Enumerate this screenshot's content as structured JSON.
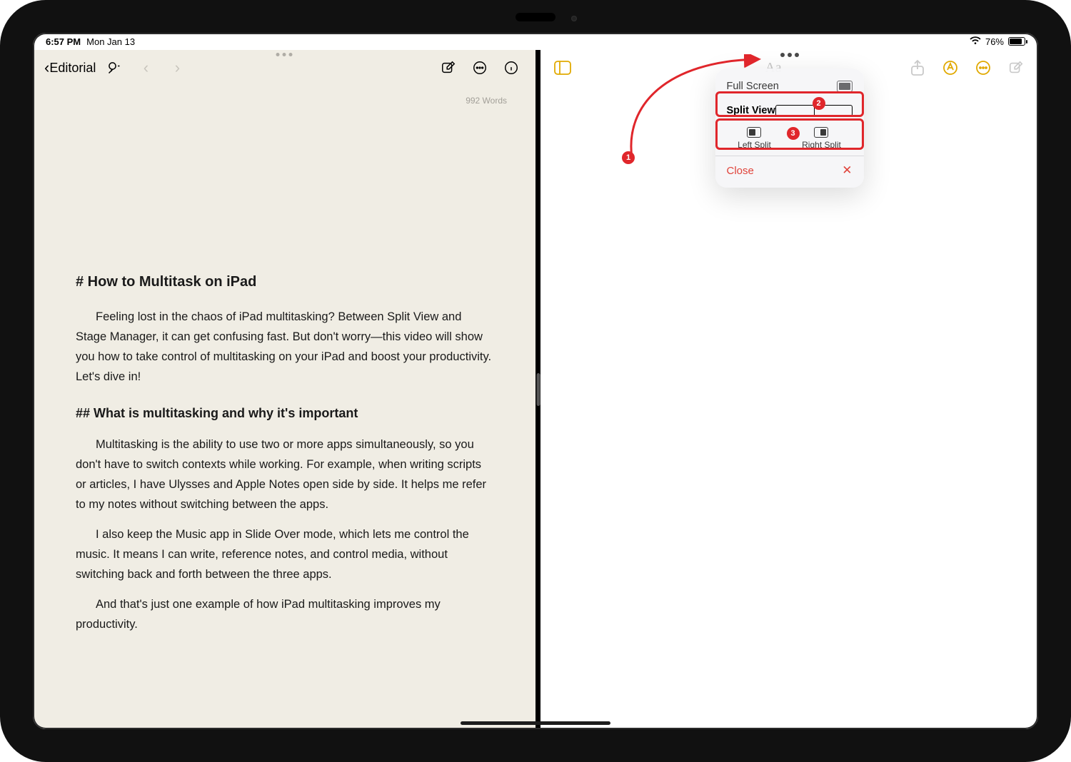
{
  "status": {
    "time": "6:57 PM",
    "date": "Mon Jan 13",
    "battery_text": "76%"
  },
  "left_app": {
    "back_label": "Editorial",
    "word_count": "992 Words",
    "document": {
      "h1": "# How to Multitask on iPad",
      "p1": "Feeling lost in the chaos of iPad multitasking? Between Split View and Stage Manager, it can get confusing fast. But don't worry—this video will show you how to take control of multitasking on your iPad and boost your productivity. Let's dive in!",
      "h2": "## What is multitasking and why it's important",
      "p2": "Multitasking is the ability to use two or more apps simultaneously, so you don't have to switch contexts while working. For example, when writing scripts or articles, I have Ulysses and Apple Notes open side by side. It helps me refer to my notes without switching between the apps.",
      "p3": "I also keep the Music app in Slide Over mode, which lets me control the music. It means I can write, reference notes, and control media, without switching back and forth between the three apps.",
      "p4": "And that's just one example of how iPad multitasking improves my productivity."
    }
  },
  "right_app": {
    "multitask_menu": {
      "full_screen": "Full Screen",
      "split_view": "Split View",
      "left_split": "Left Split",
      "right_split": "Right Split",
      "close": "Close"
    }
  },
  "annotations": {
    "step1": "1",
    "step2": "2",
    "step3": "3"
  }
}
